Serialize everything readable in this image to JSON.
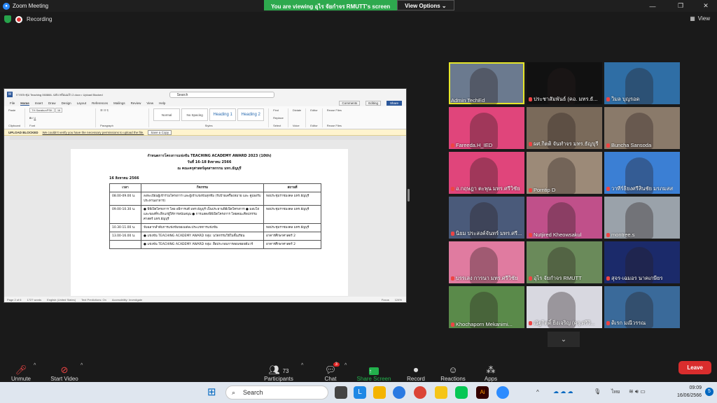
{
  "window": {
    "title": "Zoom Meeting"
  },
  "share_banner": {
    "message": "You are viewing อุไร จัยกำจร RMUTT's screen",
    "options_label": "View Options"
  },
  "recording": {
    "label": "Recording"
  },
  "view_button": {
    "label": "View"
  },
  "word": {
    "file_title": "การประชุม Teaching 060866- ฉบับ พร้อมแล้ว 2.docx • Upload Blocked",
    "search_placeholder": "Search",
    "menu": [
      "File",
      "Home",
      "Insert",
      "Draw",
      "Design",
      "Layout",
      "References",
      "Mailings",
      "Review",
      "View",
      "Help"
    ],
    "comments_label": "Comments",
    "editing_label": "Editing",
    "share_label": "Share",
    "font_name": "TH SarabunPSK",
    "font_size": "16",
    "styles": [
      "Normal",
      "No Spacing",
      "Heading 1",
      "Heading 2"
    ],
    "ribbon_groups": [
      "Clipboard",
      "Font",
      "Paragraph",
      "Styles",
      "Editing",
      "Voice",
      "Editor",
      "Reuse Files"
    ],
    "ribbon_buttons": [
      "Paste",
      "Find",
      "Replace",
      "Select",
      "Dictate",
      "Editor",
      "Reuse Files"
    ],
    "banner": {
      "title": "UPLOAD BLOCKED",
      "message": "We couldn't verify you have the necessary permissions to upload the file.",
      "button": "Save a Copy"
    },
    "doc": {
      "title1": "กำหนดการโครงการแข่งขัน TEACHING ACADEMY AWARD 2023 (10th)",
      "title2": "วันที่ 16-18 สิงหาคม 2566",
      "title3": "ณ คณะครุศาสตร์อุตสาหกรรม มทร.ธัญบุรี",
      "date": "16 สิงหาคม 2566",
      "headers": [
        "เวลา",
        "กิจกรรม",
        "สถานที่"
      ],
      "rows": [
        {
          "time": "08.00-09.00 น.",
          "activity": "ลงทะเบียนผู้เข้าร่วมโครงการ และผู้เข้าแข่งขันทุกทีม (รับป้ายเครื่องหมาย และ คูปองรับประทานอาหาร)",
          "place": "หอประชุมราชมงคล มทร.ธัญบุรี"
        },
        {
          "time": "09.00-10.30 น.",
          "activity": "● พิธีเปิดโครงการ โดย อธิการบดี มทร.ธัญบุรี เป็นประธานพิธีเปิดโครงการ ● มอบโล่และของที่ระลึกแก่ผู้ให้การสนับสนุน ● การแสดงพิธีเปิดโครงการ โดยคณะศิลปกรรมศาสตร์ มทร.ธัญบุรี",
          "place": "หอประชุมราชมงคล มทร.ธัญบุรี"
        },
        {
          "time": "10.30-11.00 น.",
          "activity": "จับฉลากลำดับการแข่งขันของแต่ละประเภทการแข่งขัน",
          "place": "หอประชุมราชมงคล มทร.ธัญบุรี"
        },
        {
          "time": "13.00-16.00 น.",
          "activity": "● แข่งขัน TEACHING ACADEMY AWARD กลุ่ม: นวัตกรรมวิธีในชั้นเรียน",
          "place": "อาคารศึกษาศาสตร์ 2"
        },
        {
          "time": "",
          "activity": "● แข่งขัน TEACHING ACADEMY AWARD กลุ่ม: สื่อประกอบการสอนซอฟต์แวร์",
          "place": "อาคารศึกษาศาสตร์ 2"
        }
      ]
    },
    "status": [
      "Page 2 of 6",
      "1727 words",
      "English (United States)",
      "Text Predictions: On",
      "Accessibility: Investigate",
      "Focus",
      "124%"
    ]
  },
  "participants": [
    {
      "name": "Admin TechEd",
      "muted": false,
      "color": "#6b7a8f"
    },
    {
      "name": "ประชาสัมพันธ์ (คอ. มทร.ธั...",
      "muted": true,
      "color": "#111"
    },
    {
      "name": "วิมล บุญรอด",
      "muted": true,
      "color": "#2f6ea5"
    },
    {
      "name": "Fareeda.H_IED",
      "muted": true,
      "color": "#e0457b"
    },
    {
      "name": "ผศ.กิตติ จันทำจร มทร.ธัญบุรี",
      "muted": true,
      "color": "#7a6a5a"
    },
    {
      "name": "Buncha Sansoda",
      "muted": true,
      "color": "#8a7a6a"
    },
    {
      "name": "อ.กฤษฎา ตะพุน มทร.ศรีวิชัย",
      "muted": true,
      "color": "#e0457b"
    },
    {
      "name": "Porntip D",
      "muted": true,
      "color": "#9c8a78"
    },
    {
      "name": "วาทีร์ธิยงศรีสินชัย มรภมสส",
      "muted": true,
      "color": "#3b7fd4"
    },
    {
      "name": "นิยม ประสงค์จันทร์ มทร.ศรี...",
      "muted": true,
      "color": "#4a5a7a"
    },
    {
      "name": "Nutjired Kheowsakul",
      "muted": true,
      "color": "#c0508a"
    },
    {
      "name": "montree.s",
      "muted": true,
      "color": "#9aa2aa"
    },
    {
      "name": "บรรเลง การนา มทร.ศรีวิชัย",
      "muted": true,
      "color": "#e07ba0"
    },
    {
      "name": "อุไร จัยกำจร RMUTT",
      "muted": true,
      "color": "#6a8a5a"
    },
    {
      "name": "สุจร-เฉมอร นาคเกษียร",
      "muted": true,
      "color": "#1b2a6a"
    },
    {
      "name": "Khochaporn Mekanimi...",
      "muted": true,
      "color": "#5a8a4a"
    },
    {
      "name": "ณัฐกิตติ์ ยิ่งเจริญ (ครุ.ศรีวิ...",
      "muted": true,
      "color": "#d8d8e0"
    },
    {
      "name": "ดิเรก มณีวรรณ",
      "muted": true,
      "color": "#3a6a9a"
    }
  ],
  "controls": {
    "unmute": "Unmute",
    "start_video": "Start Video",
    "participants": "Participants",
    "participants_count": "73",
    "chat": "Chat",
    "chat_badge": "3",
    "share_screen": "Share Screen",
    "record": "Record",
    "reactions": "Reactions",
    "apps": "Apps",
    "leave": "Leave"
  },
  "taskbar": {
    "search_label": "Search",
    "lang": "ไทย",
    "time": "09:09",
    "date": "16/06/2566"
  }
}
